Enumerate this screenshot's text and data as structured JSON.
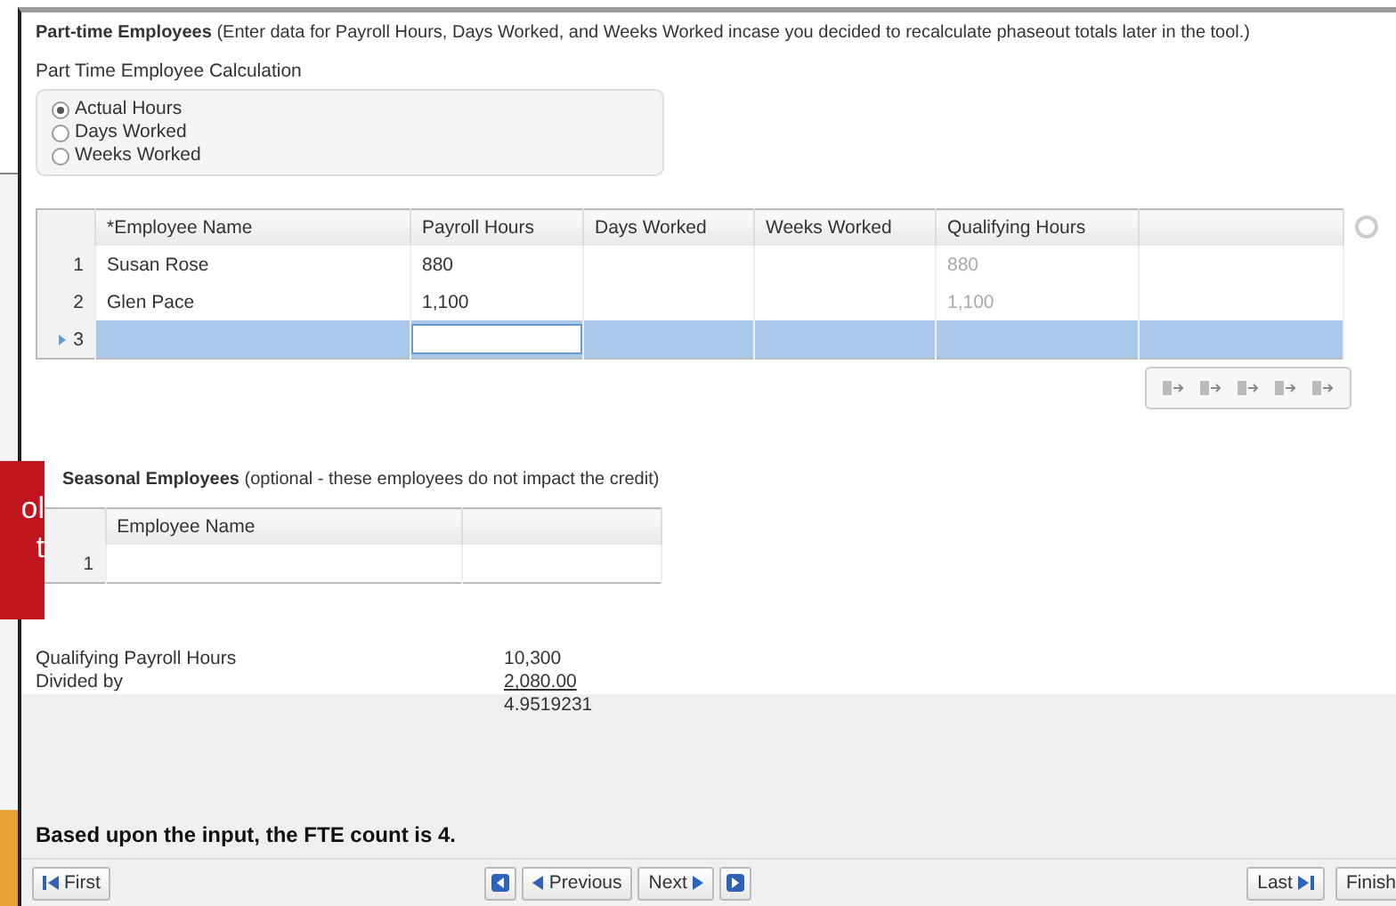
{
  "part_time": {
    "title": "Part-time Employees",
    "note": "(Enter data for Payroll Hours, Days Worked, and Weeks Worked incase you decided to recalculate phaseout totals later in the tool.)",
    "calc_label": "Part Time Employee Calculation",
    "options": [
      {
        "label": "Actual Hours",
        "selected": true
      },
      {
        "label": "Days Worked",
        "selected": false
      },
      {
        "label": "Weeks Worked",
        "selected": false
      }
    ],
    "table": {
      "columns": [
        "*Employee Name",
        "Payroll Hours",
        "Days Worked",
        "Weeks Worked",
        "Qualifying Hours"
      ],
      "rows": [
        {
          "num": "1",
          "cells": [
            "Susan Rose",
            "880",
            "",
            "",
            "880"
          ],
          "selected": false
        },
        {
          "num": "2",
          "cells": [
            "Glen Pace",
            "1,100",
            "",
            "",
            "1,100"
          ],
          "selected": false
        },
        {
          "num": "3",
          "cells": [
            "",
            "",
            "",
            "",
            ""
          ],
          "selected": true
        }
      ]
    }
  },
  "callout": {
    "lines": [
      "ol",
      "t"
    ]
  },
  "seasonal": {
    "title": "Seasonal Employees",
    "note": "(optional - these employees do not impact the credit)",
    "table": {
      "columns": [
        "Employee Name"
      ],
      "rows": [
        {
          "num": "1"
        }
      ]
    }
  },
  "summary": {
    "rows": [
      {
        "label": "Qualifying Payroll Hours",
        "value": "10,300"
      },
      {
        "label": "Divided by",
        "value": "2,080.00"
      }
    ],
    "result": "4.9519231"
  },
  "fte_text": "Based upon the input, the FTE count is 4.",
  "nav": {
    "first": "First",
    "previous": "Previous",
    "next": "Next",
    "last": "Last",
    "finish": "Finish"
  }
}
